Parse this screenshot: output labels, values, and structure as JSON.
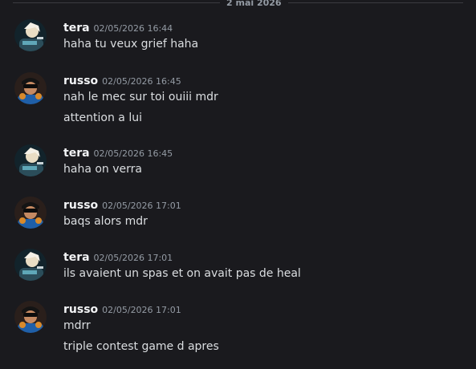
{
  "divider": {
    "label": "2 mai 2026"
  },
  "messages": [
    {
      "author": "tera",
      "timestamp": "02/05/2026 16:44",
      "avatar_icon": "anime-character-avatar",
      "lines": [
        "haha tu veux grief haha"
      ]
    },
    {
      "author": "russo",
      "timestamp": "02/05/2026 16:45",
      "avatar_icon": "sunglasses-character-avatar",
      "lines": [
        "nah le mec sur toi ouiii mdr",
        "attention a lui"
      ]
    },
    {
      "author": "tera",
      "timestamp": "02/05/2026 16:45",
      "avatar_icon": "anime-character-avatar",
      "lines": [
        "haha on verra"
      ]
    },
    {
      "author": "russo",
      "timestamp": "02/05/2026 17:01",
      "avatar_icon": "sunglasses-character-avatar",
      "lines": [
        "baqs alors mdr"
      ]
    },
    {
      "author": "tera",
      "timestamp": "02/05/2026 17:01",
      "avatar_icon": "anime-character-avatar",
      "lines": [
        "ils avaient un spas et on avait pas de heal"
      ]
    },
    {
      "author": "russo",
      "timestamp": "02/05/2026 17:01",
      "avatar_icon": "sunglasses-character-avatar",
      "lines": [
        "mdrr",
        "triple contest game d apres"
      ]
    }
  ],
  "colors": {
    "background": "#1a1a1e",
    "author": "#f2f3f5",
    "timestamp": "#949ba4",
    "message_text": "#dbdee1"
  }
}
